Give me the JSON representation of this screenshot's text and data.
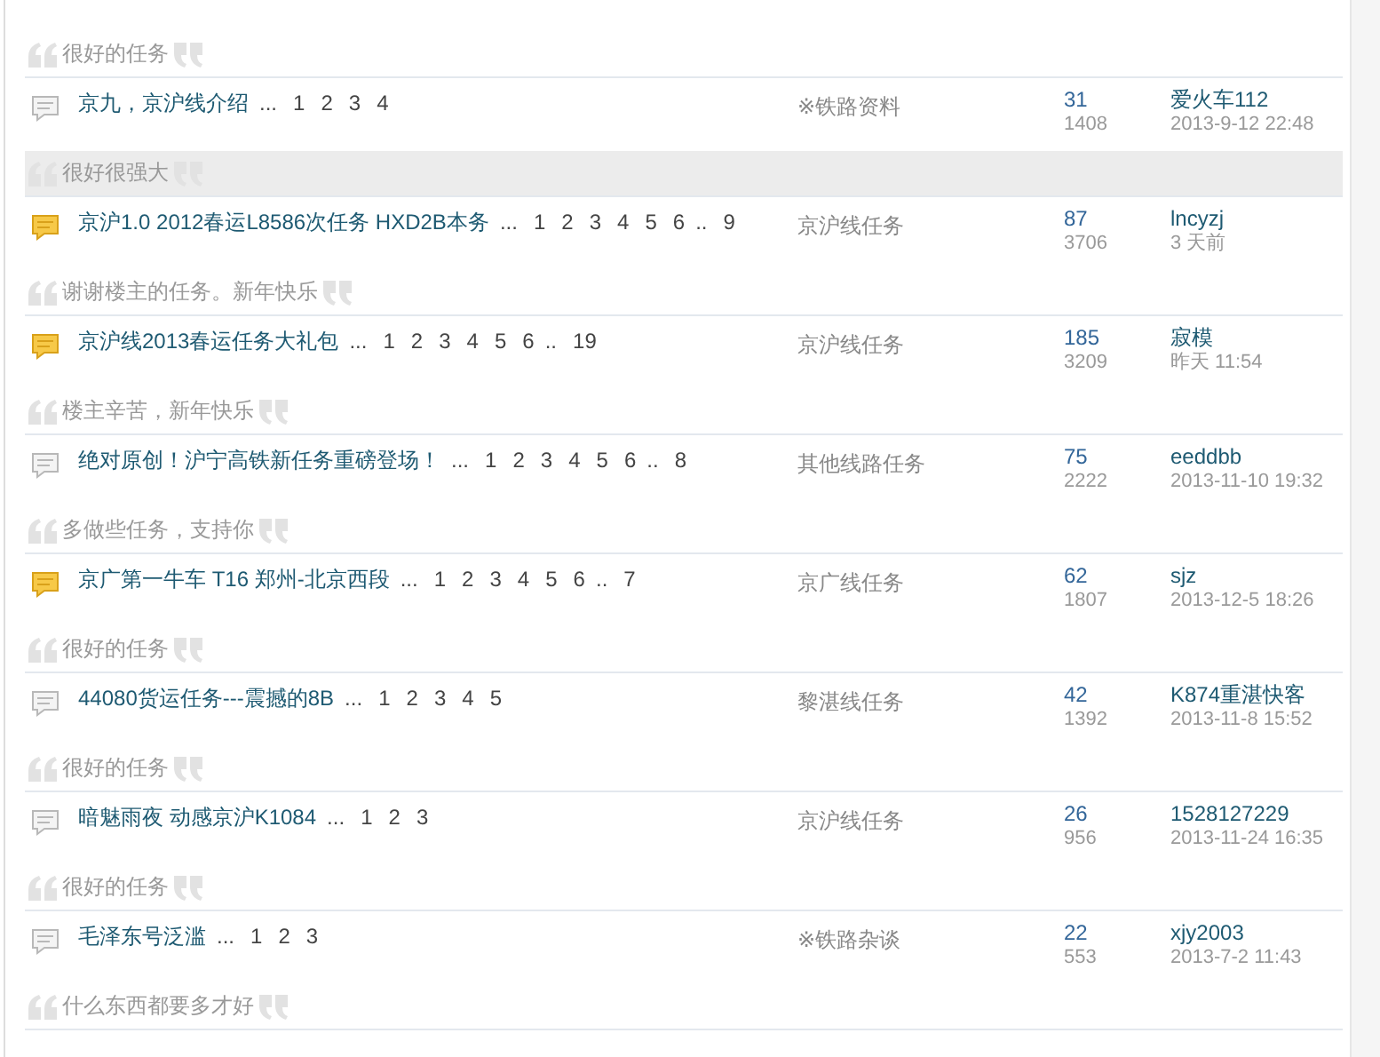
{
  "first_quote": {
    "text": "很好的任务",
    "highlighted": false
  },
  "topics": [
    {
      "kind": "normal",
      "title": "京九，京沪线介绍",
      "ellipsis": "...",
      "pages": [
        {
          "label": "1",
          "kind": "page"
        },
        {
          "label": "2",
          "kind": "page"
        },
        {
          "label": "3",
          "kind": "page"
        },
        {
          "label": "4",
          "kind": "page"
        }
      ],
      "forum": "※铁路资料",
      "replies": "31",
      "views": "1408",
      "author": "爱火车112",
      "time": "2013-9-12 22:48",
      "quote": {
        "text": "很好很强大",
        "highlighted": true
      }
    },
    {
      "kind": "hot",
      "title": "京沪1.0 2012春运L8586次任务  HXD2B本务",
      "ellipsis": "...",
      "pages": [
        {
          "label": "1",
          "kind": "page"
        },
        {
          "label": "2",
          "kind": "page"
        },
        {
          "label": "3",
          "kind": "page"
        },
        {
          "label": "4",
          "kind": "page"
        },
        {
          "label": "5",
          "kind": "page"
        },
        {
          "label": "6",
          "kind": "page"
        },
        {
          "label": "..",
          "kind": "gap"
        },
        {
          "label": "9",
          "kind": "page"
        }
      ],
      "forum": "京沪线任务",
      "replies": "87",
      "views": "3706",
      "author": "lncyzj",
      "time": "3 天前",
      "quote": {
        "text": "谢谢楼主的任务。新年快乐",
        "highlighted": false
      }
    },
    {
      "kind": "hot",
      "title": "京沪线2013春运任务大礼包",
      "ellipsis": "...",
      "pages": [
        {
          "label": "1",
          "kind": "page"
        },
        {
          "label": "2",
          "kind": "page"
        },
        {
          "label": "3",
          "kind": "page"
        },
        {
          "label": "4",
          "kind": "page"
        },
        {
          "label": "5",
          "kind": "page"
        },
        {
          "label": "6",
          "kind": "page"
        },
        {
          "label": "..",
          "kind": "gap"
        },
        {
          "label": "19",
          "kind": "page"
        }
      ],
      "forum": "京沪线任务",
      "replies": "185",
      "views": "3209",
      "author": "寂模",
      "time": "昨天 11:54",
      "quote": {
        "text": "楼主辛苦，新年快乐",
        "highlighted": false
      }
    },
    {
      "kind": "normal",
      "title": "绝对原创！沪宁高铁新任务重磅登场！",
      "ellipsis": "...",
      "pages": [
        {
          "label": "1",
          "kind": "page"
        },
        {
          "label": "2",
          "kind": "page"
        },
        {
          "label": "3",
          "kind": "page"
        },
        {
          "label": "4",
          "kind": "page"
        },
        {
          "label": "5",
          "kind": "page"
        },
        {
          "label": "6",
          "kind": "page"
        },
        {
          "label": "..",
          "kind": "gap"
        },
        {
          "label": "8",
          "kind": "page"
        }
      ],
      "forum": "其他线路任务",
      "replies": "75",
      "views": "2222",
      "author": "eeddbb",
      "time": "2013-11-10 19:32",
      "quote": {
        "text": "多做些任务，支持你",
        "highlighted": false
      }
    },
    {
      "kind": "hot",
      "title": "京广第一牛车  T16 郑州-北京西段",
      "ellipsis": "...",
      "pages": [
        {
          "label": "1",
          "kind": "page"
        },
        {
          "label": "2",
          "kind": "page"
        },
        {
          "label": "3",
          "kind": "page"
        },
        {
          "label": "4",
          "kind": "page"
        },
        {
          "label": "5",
          "kind": "page"
        },
        {
          "label": "6",
          "kind": "page"
        },
        {
          "label": "..",
          "kind": "gap"
        },
        {
          "label": "7",
          "kind": "page"
        }
      ],
      "forum": "京广线任务",
      "replies": "62",
      "views": "1807",
      "author": "sjz",
      "time": "2013-12-5 18:26",
      "quote": {
        "text": "很好的任务",
        "highlighted": false
      }
    },
    {
      "kind": "normal",
      "title": "44080货运任务---震撼的8B",
      "ellipsis": "...",
      "pages": [
        {
          "label": "1",
          "kind": "page"
        },
        {
          "label": "2",
          "kind": "page"
        },
        {
          "label": "3",
          "kind": "page"
        },
        {
          "label": "4",
          "kind": "page"
        },
        {
          "label": "5",
          "kind": "page"
        }
      ],
      "forum": "黎湛线任务",
      "replies": "42",
      "views": "1392",
      "author": "K874重湛快客",
      "time": "2013-11-8 15:52",
      "quote": {
        "text": "很好的任务",
        "highlighted": false
      }
    },
    {
      "kind": "normal",
      "title": "暗魅雨夜 动感京沪K1084",
      "ellipsis": "...",
      "pages": [
        {
          "label": "1",
          "kind": "page"
        },
        {
          "label": "2",
          "kind": "page"
        },
        {
          "label": "3",
          "kind": "page"
        }
      ],
      "forum": "京沪线任务",
      "replies": "26",
      "views": "956",
      "author": "1528127229",
      "time": "2013-11-24 16:35",
      "quote": {
        "text": "很好的任务",
        "highlighted": false
      }
    },
    {
      "kind": "normal",
      "title": "毛泽东号泛滥",
      "ellipsis": "...",
      "pages": [
        {
          "label": "1",
          "kind": "page"
        },
        {
          "label": "2",
          "kind": "page"
        },
        {
          "label": "3",
          "kind": "page"
        }
      ],
      "forum": "※铁路杂谈",
      "replies": "22",
      "views": "553",
      "author": "xjy2003",
      "time": "2013-7-2 11:43",
      "quote": {
        "text": "什么东西都要多才好",
        "highlighted": false
      }
    }
  ]
}
